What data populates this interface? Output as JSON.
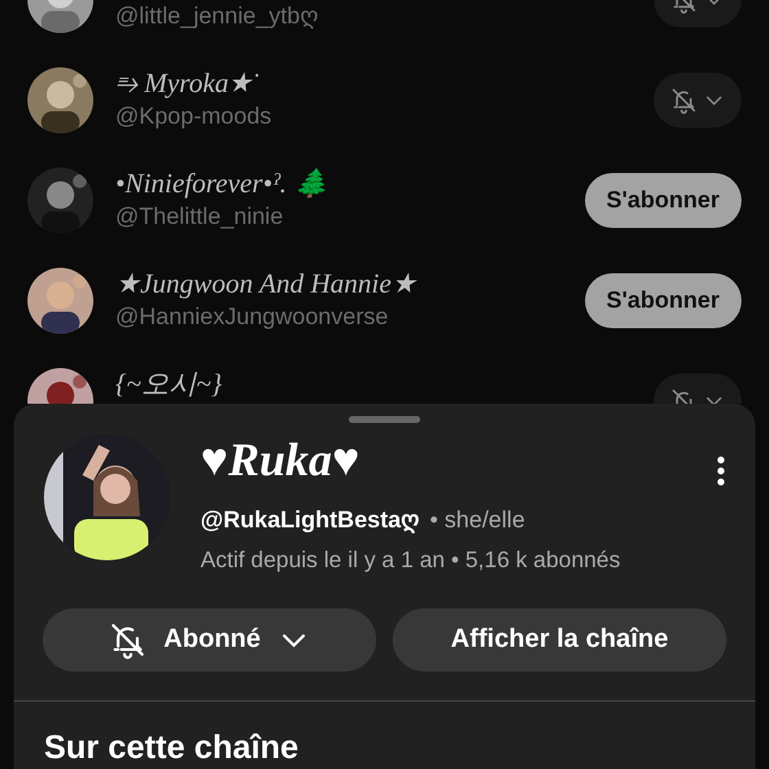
{
  "channels": [
    {
      "handle": "@little_jennie_ytbღ",
      "button": {
        "kind": "subscribed"
      }
    },
    {
      "name": "⥱ Myroka★˙",
      "handle": "@Kpop-moods",
      "button": {
        "kind": "subscribed"
      }
    },
    {
      "name": "•Ninieforever•ˀ. 🌲",
      "handle": "@Thelittle_ninie",
      "button": {
        "kind": "subscribe",
        "label": "S'abonner"
      }
    },
    {
      "name": "★Jungwoon And Hannie★",
      "handle": "@HanniexJungwoonverse",
      "button": {
        "kind": "subscribe",
        "label": "S'abonner"
      }
    },
    {
      "name": "{~오시~}",
      "button": {
        "kind": "subscribed"
      }
    }
  ],
  "sheet": {
    "title": "♥Ruka♥",
    "handle": "@RukaLightBestaღ",
    "pronouns": "• she/elle",
    "stats": "Actif depuis le il y a 1 an • 5,16 k abonnés",
    "subscribe_button": {
      "label": "Abonné"
    },
    "view_button": {
      "label": "Afficher la chaîne"
    },
    "section_title": "Sur cette chaîne"
  }
}
